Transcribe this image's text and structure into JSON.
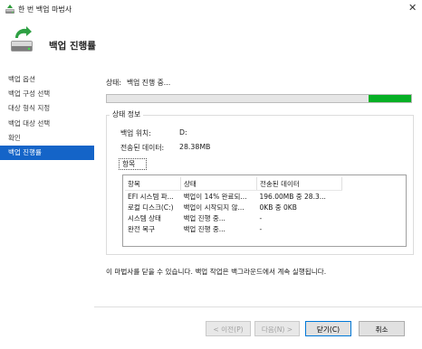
{
  "window": {
    "title": "한 번 백업 마법사",
    "close_glyph": "✕"
  },
  "header": {
    "title": "백업 진행률",
    "icon": "backup-drive-icon"
  },
  "sidebar": {
    "items": [
      {
        "label": "백업 옵션",
        "active": false
      },
      {
        "label": "백업 구성 선택",
        "active": false
      },
      {
        "label": "대상 형식 지정",
        "active": false
      },
      {
        "label": "백업 대상 선택",
        "active": false
      },
      {
        "label": "확인",
        "active": false
      },
      {
        "label": "백업 진행률",
        "active": true
      }
    ]
  },
  "status": {
    "label": "상태:",
    "value": "백업 진행 중...",
    "progress_fraction": 0.14,
    "progress_color": "#06b025"
  },
  "status_info": {
    "group_title": "상태 정보",
    "backup_location_label": "백업 위치:",
    "backup_location_value": "D:",
    "transferred_label": "전송된 데이터:",
    "transferred_value": "28.38MB",
    "items_label": "항목"
  },
  "items_table": {
    "columns": [
      "항목",
      "상태",
      "전송된 데이터"
    ],
    "rows": [
      [
        "EFI 시스템 파...",
        "백업이 14% 완료되...",
        "196.00MB 중 28.3..."
      ],
      [
        "로컬 디스크(C:)",
        "백업이 시작되지 않...",
        "0KB 중 0KB"
      ],
      [
        "시스템 상태",
        "백업 진행 중...",
        "-"
      ],
      [
        "완전 복구",
        "백업 진행 중...",
        "-"
      ]
    ]
  },
  "note": "이 마법사를 닫을 수 있습니다. 백업 작업은 백그라운드에서 계속 실행됩니다.",
  "buttons": {
    "prev": "< 이전(P)",
    "next": "다음(N) >",
    "close": "닫기(C)",
    "cancel": "취소"
  },
  "colors": {
    "sidebar_active": "#1464c8",
    "default_button_border": "#0078d7"
  }
}
